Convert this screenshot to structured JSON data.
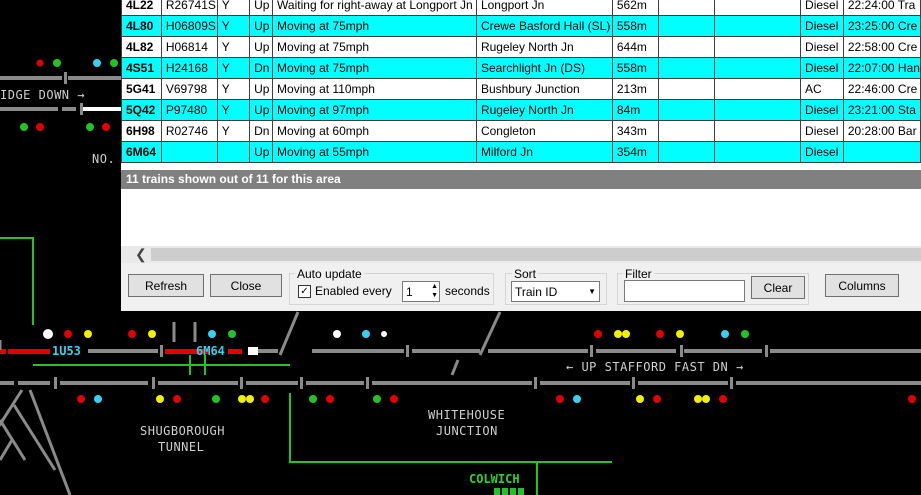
{
  "trains": {
    "rows": [
      {
        "id": "4L22",
        "headcode": "R26741S",
        "flag": "Y",
        "dir": "Up",
        "status": "Waiting for right-away at Longport Jn",
        "location": "Longport Jn",
        "length": "562m",
        "c8": "",
        "c9": "",
        "traction": "Diesel",
        "schedule": "22:24:00 Tra",
        "style": "white"
      },
      {
        "id": "4L80",
        "headcode": "H06809S",
        "flag": "Y",
        "dir": "Up",
        "status": "Moving at 75mph",
        "location": "Crewe Basford Hall (SL)",
        "length": "558m",
        "c8": "",
        "c9": "",
        "traction": "Diesel",
        "schedule": "23:25:00 Cre",
        "style": "cyan"
      },
      {
        "id": "4L82",
        "headcode": "H06814",
        "flag": "Y",
        "dir": "Up",
        "status": "Moving at 75mph",
        "location": "Rugeley North Jn",
        "length": "644m",
        "c8": "",
        "c9": "",
        "traction": "Diesel",
        "schedule": "22:58:00 Cre",
        "style": "white"
      },
      {
        "id": "4S51",
        "headcode": "H24168",
        "flag": "Y",
        "dir": "Dn",
        "status": "Moving at 75mph",
        "location": "Searchlight Jn (DS)",
        "length": "558m",
        "c8": "",
        "c9": "",
        "traction": "Diesel",
        "schedule": "22:07:00 Han",
        "style": "cyan"
      },
      {
        "id": "5G41",
        "headcode": "V69798",
        "flag": "Y",
        "dir": "Up",
        "status": "Moving at 110mph",
        "location": "Bushbury Junction",
        "length": "213m",
        "c8": "",
        "c9": "",
        "traction": "AC",
        "schedule": "22:46:00 Cre",
        "style": "white"
      },
      {
        "id": "5Q42",
        "headcode": "P97480",
        "flag": "Y",
        "dir": "Up",
        "status": "Moving at 97mph",
        "location": "Rugeley North Jn",
        "length": "84m",
        "c8": "",
        "c9": "",
        "traction": "Diesel",
        "schedule": "23:21:00 Sta",
        "style": "cyan"
      },
      {
        "id": "6H98",
        "headcode": "R02746",
        "flag": "Y",
        "dir": "Dn",
        "status": "Moving at 60mph",
        "location": "Congleton",
        "length": "343m",
        "c8": "",
        "c9": "",
        "traction": "Diesel",
        "schedule": "20:28:00 Bar",
        "style": "white"
      },
      {
        "id": "6M64",
        "headcode": "",
        "flag": "",
        "dir": "Up",
        "status": "Moving at 55mph",
        "location": "Milford Jn",
        "length": "354m",
        "c8": "",
        "c9": "",
        "traction": "Diesel",
        "schedule": "",
        "style": "cyan"
      }
    ],
    "summary": "11 trains shown out of 11 for this area"
  },
  "controls": {
    "refresh_label": "Refresh",
    "close_label": "Close",
    "auto_update_title": "Auto update",
    "enabled_label": "Enabled every",
    "enabled_checked": true,
    "interval_value": "1",
    "seconds_label": "seconds",
    "sort_title": "Sort",
    "sort_value": "Train ID",
    "filter_title": "Filter",
    "filter_value": "",
    "clear_label": "Clear",
    "columns_label": "Columns"
  },
  "diagram": {
    "labels": {
      "idge_down": "IDGE DOWN",
      "no": "NO.",
      "up_stafford": "UP STAFFORD FAST DN",
      "shugborough_1": "SHUGBOROUGH",
      "shugborough_2": "TUNNEL",
      "whitehouse_1": "WHITEHOUSE",
      "whitehouse_2": "JUNCTION",
      "colwich": "COLWICH"
    },
    "berths": {
      "b1": "1U53",
      "b2": "6M64"
    },
    "colors": {
      "track": "#8a8a8a",
      "occupied": "#e00000",
      "green": "#22c422",
      "cyan": "#38d0f0",
      "yellow": "#f0f000",
      "white": "#ffffff"
    }
  }
}
